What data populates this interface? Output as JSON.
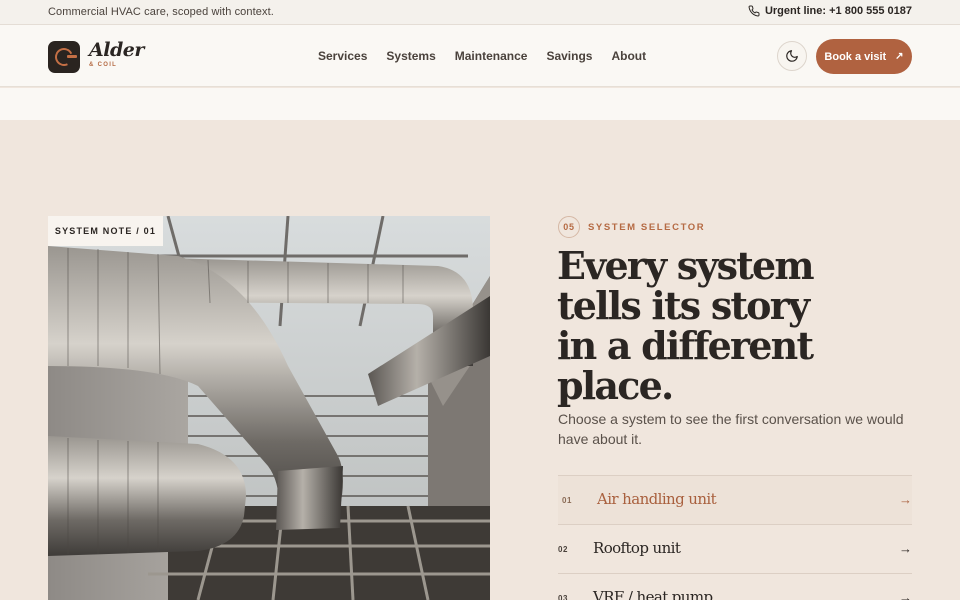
{
  "topbar": {
    "tagline": "Commercial HVAC care, scoped with context.",
    "urgent": "Urgent line: +1 800 555 0187",
    "phone_icon": "phone-icon"
  },
  "brand": {
    "name": "Alder",
    "sub": "& COIL",
    "accent": "#b56a43",
    "dark": "#2a2420"
  },
  "nav": {
    "items": [
      "Services",
      "Systems",
      "Maintenance",
      "Savings",
      "About"
    ]
  },
  "actions": {
    "theme_icon": "moon-icon",
    "book_label": "Book a visit",
    "book_arrow": "↗",
    "book_color": "#b06240"
  },
  "photo": {
    "tag": "SYSTEM NOTE / 01"
  },
  "section": {
    "step": "05",
    "eyebrow": "SYSTEM SELECTOR",
    "headline_lines": [
      "Every system",
      "tells its story",
      "in a different",
      "place."
    ],
    "lede": "Choose a system to see the first conversation we would have about it."
  },
  "systems": [
    {
      "num": "01",
      "name": "Air handling unit",
      "arrow": "→",
      "active": true
    },
    {
      "num": "02",
      "name": "Rooftop unit",
      "arrow": "→",
      "active": false
    },
    {
      "num": "03",
      "name": "VRF / heat pump",
      "arrow": "→",
      "active": false
    }
  ]
}
